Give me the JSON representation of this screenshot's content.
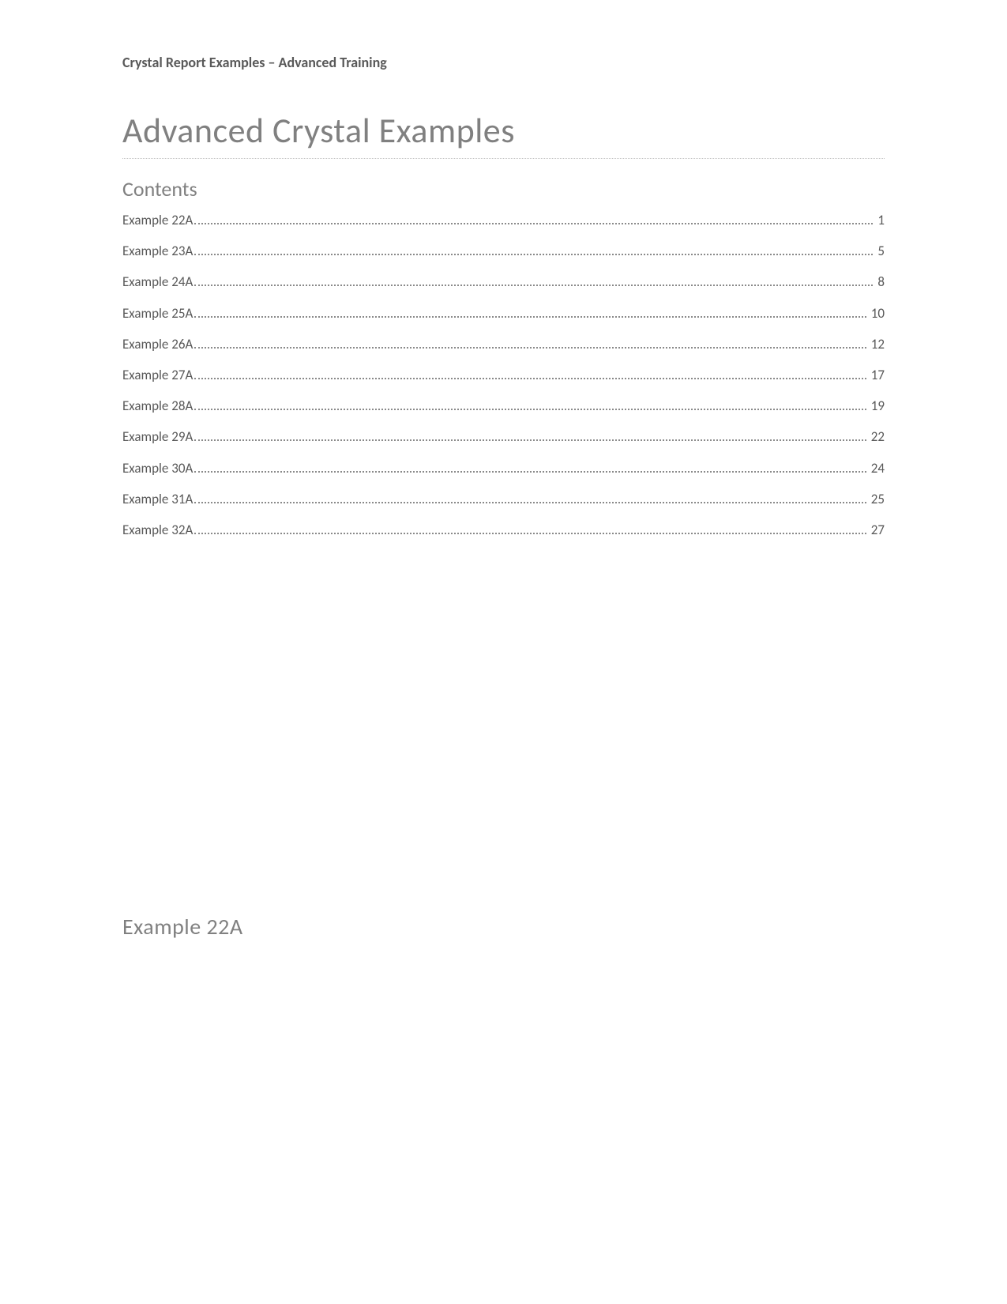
{
  "header": "Crystal Report Examples – Advanced Training",
  "title": "Advanced Crystal Examples",
  "contents_heading": "Contents",
  "toc": [
    {
      "label": "Example 22A",
      "page": "1"
    },
    {
      "label": "Example 23A",
      "page": "5"
    },
    {
      "label": "Example 24A",
      "page": "8"
    },
    {
      "label": "Example 25A",
      "page": "10"
    },
    {
      "label": "Example 26A",
      "page": "12"
    },
    {
      "label": "Example 27A",
      "page": "17"
    },
    {
      "label": "Example 28A",
      "page": "19"
    },
    {
      "label": "Example 29A",
      "page": "22"
    },
    {
      "label": "Example 30A",
      "page": "24"
    },
    {
      "label": "Example 31A",
      "page": "25"
    },
    {
      "label": "Example 32A",
      "page": "27"
    }
  ],
  "section_heading": "Example 22A"
}
